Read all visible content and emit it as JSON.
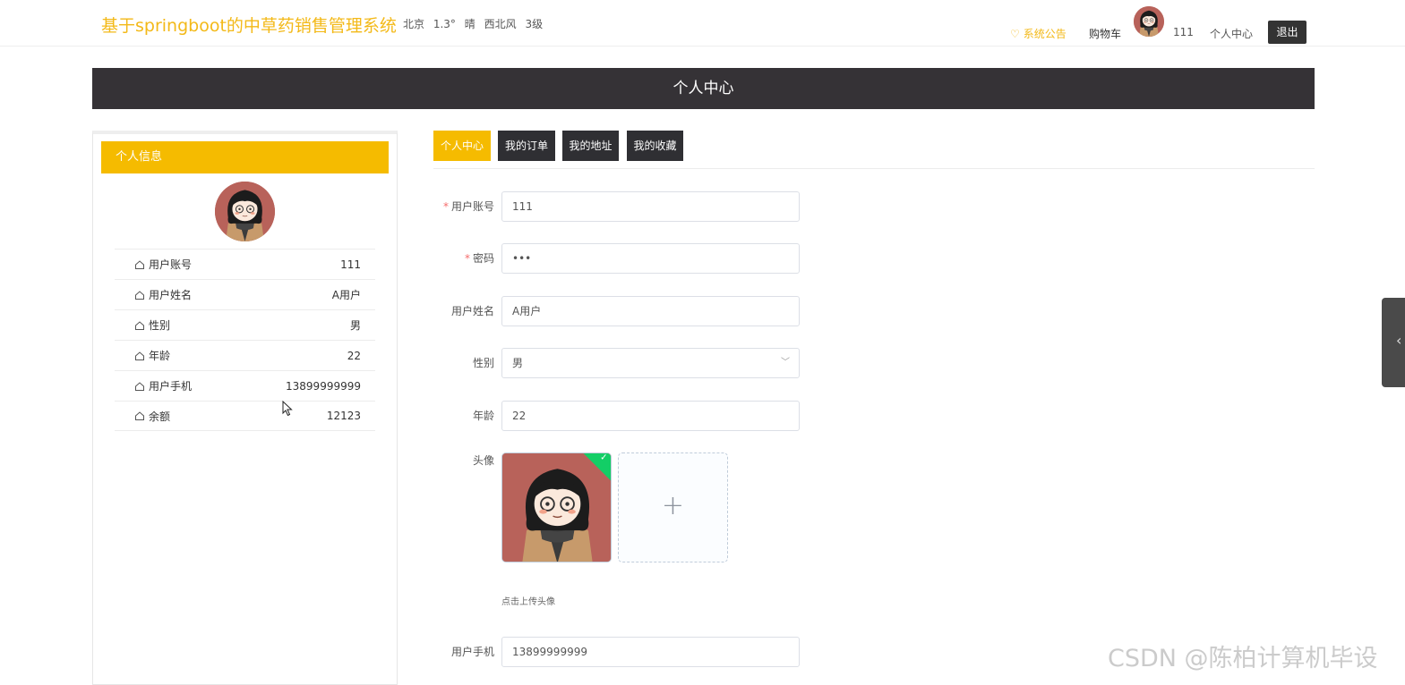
{
  "header": {
    "site_title": "基于springboot的中草药销售管理系统",
    "weather": {
      "city": "北京",
      "temp": "1.3°",
      "condition": "晴",
      "wind": "西北风",
      "level": "3级"
    },
    "nav": {
      "notice": "系统公告",
      "cart": "购物车",
      "username": "111",
      "center": "个人中心",
      "logout": "退出"
    }
  },
  "banner": {
    "title": "个人中心"
  },
  "profile": {
    "heading": "个人信息",
    "rows": [
      {
        "label": "用户账号",
        "value": "111"
      },
      {
        "label": "用户姓名",
        "value": "A用户"
      },
      {
        "label": "性别",
        "value": "男"
      },
      {
        "label": "年龄",
        "value": "22"
      },
      {
        "label": "用户手机",
        "value": "13899999999"
      },
      {
        "label": "余额",
        "value": "12123"
      }
    ]
  },
  "tabs": [
    {
      "label": "个人中心",
      "active": true
    },
    {
      "label": "我的订单",
      "active": false
    },
    {
      "label": "我的地址",
      "active": false
    },
    {
      "label": "我的收藏",
      "active": false
    }
  ],
  "form": {
    "account": {
      "label": "用户账号",
      "value": "111",
      "required": "*"
    },
    "password": {
      "label": "密码",
      "value": "•••",
      "required": "*"
    },
    "name": {
      "label": "用户姓名",
      "value": "A用户"
    },
    "gender": {
      "label": "性别",
      "value": "男"
    },
    "age": {
      "label": "年龄",
      "value": "22"
    },
    "avatar": {
      "label": "头像",
      "tip": "点击上传头像",
      "add_symbol": "+"
    },
    "phone": {
      "label": "用户手机",
      "value": "13899999999"
    }
  },
  "watermark": "CSDN @陈柏计算机毕设",
  "icons": {
    "notice": "heart-icon",
    "row": "home-icon",
    "select": "chevron-down-icon",
    "drawer": "chevron-left-icon"
  },
  "colors": {
    "accent": "#f5bb00",
    "dark": "#353236",
    "success": "#13ce66"
  }
}
